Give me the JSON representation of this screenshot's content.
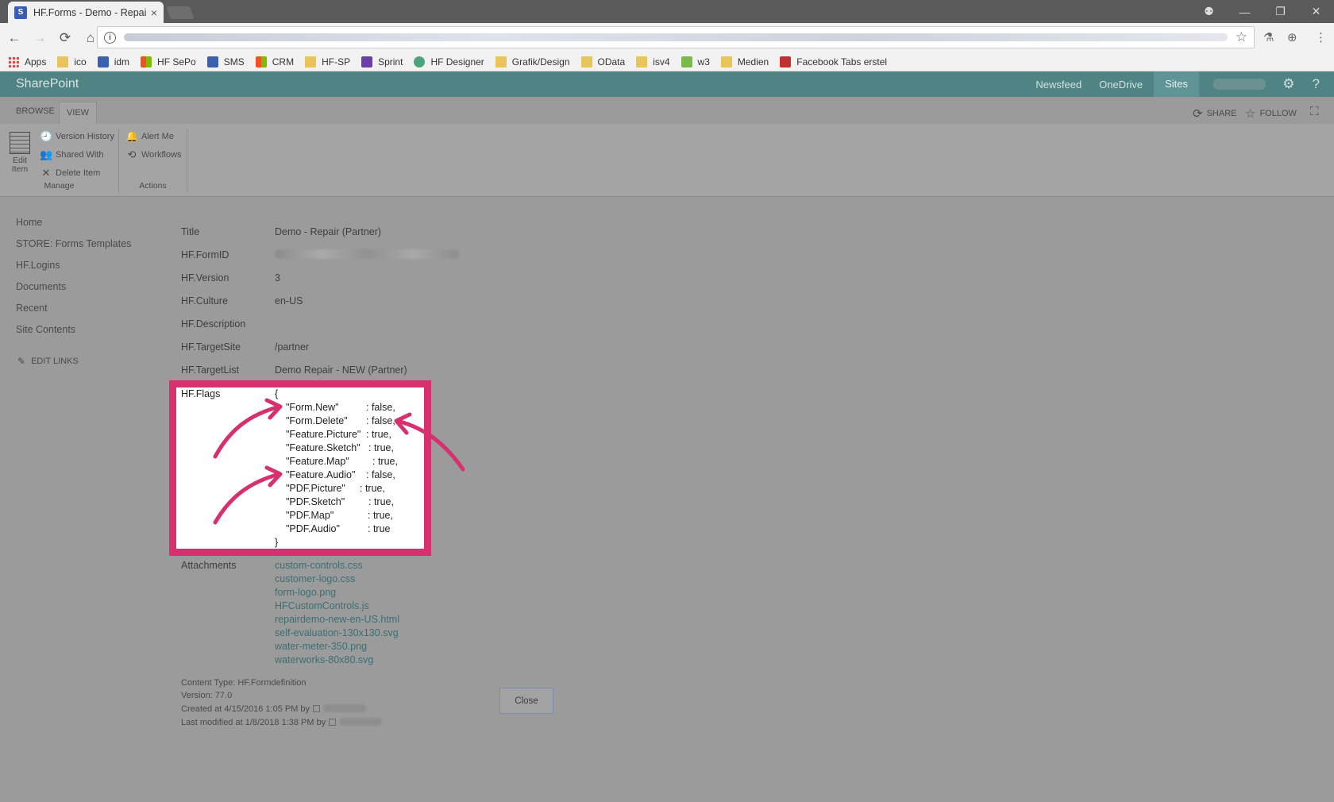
{
  "browser": {
    "tab_title": "HF.Forms - Demo - Repair (Partner)",
    "tab_close": "×",
    "win_controls": [
      "⚉",
      "—",
      "❐",
      "✕"
    ],
    "nav": {
      "back": "←",
      "forward": "→",
      "reload": "⟳",
      "home": "⌂"
    },
    "omnibox": {
      "info": "i",
      "star": "☆"
    },
    "extensions": [
      "⚗",
      "⊕",
      "⋮"
    ],
    "bookmarks": [
      {
        "label": "Apps",
        "icon": "grid"
      },
      {
        "label": "ico",
        "icon": "folder"
      },
      {
        "label": "idm",
        "icon": "sp"
      },
      {
        "label": "HF SePo",
        "icon": "ms"
      },
      {
        "label": "SMS",
        "icon": "sp"
      },
      {
        "label": "CRM",
        "icon": "ms"
      },
      {
        "label": "HF-SP",
        "icon": "folder"
      },
      {
        "label": "Sprint",
        "icon": "vs"
      },
      {
        "label": "HF Designer",
        "icon": "hf"
      },
      {
        "label": "Grafik/Design",
        "icon": "folder"
      },
      {
        "label": "OData",
        "icon": "folder"
      },
      {
        "label": "isv4",
        "icon": "folder"
      },
      {
        "label": "w3",
        "icon": "w3"
      },
      {
        "label": "Medien",
        "icon": "folder"
      },
      {
        "label": "Facebook Tabs erstel",
        "icon": "mx"
      }
    ]
  },
  "suitebar": {
    "brand": "SharePoint",
    "links": [
      "Newsfeed",
      "OneDrive",
      "Sites"
    ],
    "icons": [
      "⚙",
      "?"
    ]
  },
  "ribbon": {
    "tabs": [
      "BROWSE",
      "VIEW"
    ],
    "right": [
      {
        "label": "SHARE",
        "icon": "⟳"
      },
      {
        "label": "FOLLOW",
        "icon": "☆"
      }
    ],
    "focus_icon": "⛶",
    "manage": {
      "label": "Manage",
      "edit_item": "Edit Item",
      "items": [
        {
          "label": "Version History",
          "icon": "🕘"
        },
        {
          "label": "Shared With",
          "icon": "👥"
        },
        {
          "label": "Delete Item",
          "icon": "✕"
        }
      ]
    },
    "actions": {
      "label": "Actions",
      "items": [
        {
          "label": "Alert Me",
          "icon": "🔔"
        },
        {
          "label": "Workflows",
          "icon": "⟲"
        }
      ]
    }
  },
  "leftnav": {
    "items": [
      "Home",
      "STORE: Forms Templates",
      "HF.Logins",
      "Documents",
      "Recent",
      "Site Contents"
    ],
    "edit_links": "EDIT LINKS",
    "edit_icon": "✎"
  },
  "properties": [
    {
      "label": "Title",
      "value": "Demo - Repair (Partner)"
    },
    {
      "label": "HF.FormID",
      "value": ""
    },
    {
      "label": "HF.Version",
      "value": "3"
    },
    {
      "label": "HF.Culture",
      "value": "en-US"
    },
    {
      "label": "HF.Description",
      "value": ""
    },
    {
      "label": "HF.TargetSite",
      "value": "/partner"
    },
    {
      "label": "HF.TargetList",
      "value": "Demo Repair - NEW (Partner)"
    }
  ],
  "flags": {
    "label": "HF.Flags",
    "open": "{",
    "close": "}",
    "entries": [
      {
        "key": "\"Form.New\"",
        "value": ": false,"
      },
      {
        "key": "\"Form.Delete\"",
        "value": ": false,"
      },
      {
        "key": "\"Feature.Picture\"",
        "value": ": true,"
      },
      {
        "key": "\"Feature.Sketch\"",
        "value": ": true,"
      },
      {
        "key": "\"Feature.Map\"",
        "value": ": true,"
      },
      {
        "key": "\"Feature.Audio\"",
        "value": ": false,"
      },
      {
        "key": "\"PDF.Picture\"",
        "value": ": true,"
      },
      {
        "key": "\"PDF.Sketch\"",
        "value": ": true,"
      },
      {
        "key": "\"PDF.Map\"",
        "value": ": true,"
      },
      {
        "key": "\"PDF.Audio\"",
        "value": ": true"
      }
    ],
    "highlight_color": "#d7306e"
  },
  "attachments": {
    "label": "Attachments",
    "files": [
      "custom-controls.css",
      "customer-logo.css",
      "form-logo.png",
      "HFCustomControls.js",
      "repairdemo-new-en-US.html",
      "self-evaluation-130x130.svg",
      "water-meter-350.png",
      "waterworks-80x80.svg"
    ]
  },
  "footer": {
    "content_type": "Content Type: HF.Formdefinition",
    "version": "Version: 77.0",
    "created": "Created at 4/15/2016 1:05 PM  by",
    "modified": "Last modified at 1/8/2018 1:38 PM  by",
    "close": "Close"
  }
}
